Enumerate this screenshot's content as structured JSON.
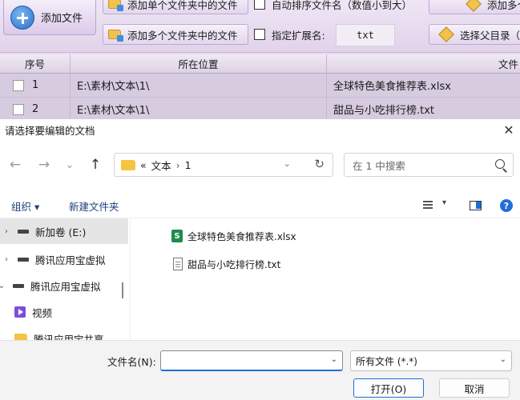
{
  "app": {
    "add_file_label": "添加文件",
    "add_single_folder_label": "添加单个文件夹中的文件",
    "add_multi_folder_label": "添加多个文件夹中的文件",
    "auto_sort_label": "自动排序文件名（数值小到大）",
    "ext_label": "指定扩展名:",
    "ext_value": "txt",
    "add_multi_partial_label": "添加多个",
    "choose_parent_label": "选择父目录（",
    "grid": {
      "headers": [
        "序号",
        "所在位置",
        "文件"
      ],
      "rows": [
        {
          "index": "1",
          "location": "E:\\素材\\文本\\1\\",
          "file": "全球特色美食推荐表.xlsx"
        },
        {
          "index": "2",
          "location": "E:\\素材\\文本\\1\\",
          "file": "甜品与小吃排行榜.txt"
        }
      ]
    }
  },
  "dialog": {
    "title": "请选择要编辑的文档",
    "close_glyph": "✕",
    "nav": {
      "back": "←",
      "forward": "→",
      "recent": "⌄",
      "up": "↑"
    },
    "address": {
      "prefix": "«",
      "parts": [
        "文本",
        "1"
      ],
      "sep": "›",
      "drop": "⌄",
      "refresh": "↻"
    },
    "search": {
      "placeholder": "在 1 中搜索"
    },
    "commands": {
      "organize": "组织 ▾",
      "new_folder": "新建文件夹",
      "view_drop": "▾",
      "help": "?"
    },
    "nav_items": [
      {
        "chev": "›",
        "label": "新加卷 (E:)",
        "icon": "drive-icon",
        "selected": true
      },
      {
        "chev": "›",
        "label": "腾讯应用宝虚拟",
        "icon": "drive-icon",
        "selected": false
      },
      {
        "chev": "⌄",
        "label": "腾讯应用宝虚拟",
        "icon": "drive-icon",
        "selected": false
      },
      {
        "chev": "",
        "label": "视频",
        "icon": "video-icon",
        "selected": false
      },
      {
        "chev": "",
        "label": "腾讯应用宝共享",
        "icon": "folder-icon",
        "selected": false
      }
    ],
    "files": [
      {
        "name": "全球特色美食推荐表.xlsx",
        "icon": "xlsx-icon",
        "icon_glyph": "S"
      },
      {
        "name": "甜品与小吃排行榜.txt",
        "icon": "txt-icon"
      }
    ],
    "footer": {
      "filename_label": "文件名(N):",
      "filename_value": "",
      "drop": "⌄",
      "file_type": "所有文件 (*.*)",
      "open_label": "打开(O)",
      "cancel_label": "取消"
    }
  },
  "colors": {
    "accent": "#1e6fd6",
    "app_bg": "#e6dcee",
    "xlsx": "#1f8c4e"
  }
}
